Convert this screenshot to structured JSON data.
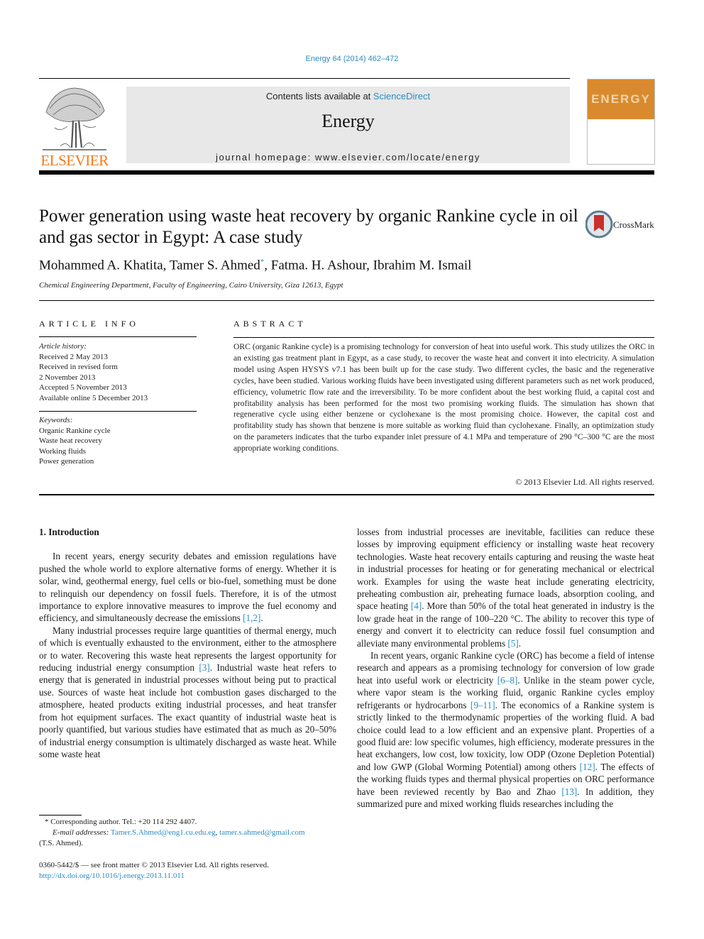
{
  "header": {
    "citation": "Energy 64 (2014) 462–472",
    "contents_prefix": "Contents lists available at ",
    "contents_link": "ScienceDirect",
    "journal_name": "Energy",
    "homepage": "journal homepage: www.elsevier.com/locate/energy",
    "publisher": "ELSEVIER",
    "cover_title": "ENERGY",
    "crossmark_label": "CrossMark"
  },
  "article": {
    "title": "Power generation using waste heat recovery by organic Rankine cycle in oil and gas sector in Egypt: A case study",
    "authors_before": "Mohammed A. Khatita, Tamer S. Ahmed",
    "authors_mark": "*",
    "authors_after": ", Fatma. H. Ashour, Ibrahim M. Ismail",
    "affiliation": "Chemical Engineering Department, Faculty of Engineering, Cairo University, Giza 12613, Egypt"
  },
  "article_info": {
    "heading": "ARTICLE INFO",
    "history_label": "Article history:",
    "history": [
      "Received 2 May 2013",
      "Received in revised form",
      "2 November 2013",
      "Accepted 5 November 2013",
      "Available online 5 December 2013"
    ],
    "keywords_label": "Keywords:",
    "keywords": [
      "Organic Rankine cycle",
      "Waste heat recovery",
      "Working fluids",
      "Power generation"
    ]
  },
  "abstract": {
    "heading": "ABSTRACT",
    "text": "ORC (organic Rankine cycle) is a promising technology for conversion of heat into useful work. This study utilizes the ORC in an existing gas treatment plant in Egypt, as a case study, to recover the waste heat and convert it into electricity. A simulation model using Aspen HYSYS v7.1 has been built up for the case study. Two different cycles, the basic and the regenerative cycles, have been studied. Various working fluids have been investigated using different parameters such as net work produced, efficiency, volumetric flow rate and the irreversibility. To be more confident about the best working fluid, a capital cost and profitability analysis has been performed for the most two promising working fluids. The simulation has shown that regenerative cycle using either benzene or cyclohexane is the most promising choice. However, the capital cost and profitability study has shown that benzene is more suitable as working fluid than cyclohexane. Finally, an optimization study on the parameters indicates that the turbo expander inlet pressure of 4.1 MPa and temperature of 290 °C–300 °C are the most appropriate working conditions.",
    "copyright": "© 2013 Elsevier Ltd. All rights reserved."
  },
  "body": {
    "section_heading": "1.  Introduction",
    "left": {
      "p1_text": "In recent years, energy security debates and emission regulations have pushed the whole world to explore alternative forms of energy. Whether it is solar, wind, geothermal energy, fuel cells or bio-fuel, something must be done to relinquish our dependency on fossil fuels. Therefore, it is of the utmost importance to explore innovative measures to improve the fuel economy and efficiency, and simultaneously decrease the emissions ",
      "p1_ref": "[1,2]",
      "p1_end": ".",
      "p2_a": "Many industrial processes require large quantities of thermal energy, much of which is eventually exhausted to the environment, either to the atmosphere or to water. Recovering this waste heat represents the largest opportunity for reducing industrial energy consumption ",
      "p2_ref": "[3]",
      "p2_b": ". Industrial waste heat refers to energy that is generated in industrial processes without being put to practical use. Sources of waste heat include hot combustion gases discharged to the atmosphere, heated products exiting industrial processes, and heat transfer from hot equipment surfaces. The exact quantity of industrial waste heat is poorly quantified, but various studies have estimated that as much as 20–50% of industrial energy consumption is ultimately discharged as waste heat. While some waste heat"
    },
    "right": {
      "p1_a": "losses from industrial processes are inevitable, facilities can reduce these losses by improving equipment efficiency or installing waste heat recovery technologies. Waste heat recovery entails capturing and reusing the waste heat in industrial processes for heating or for generating mechanical or electrical work. Examples for using the waste heat include generating electricity, preheating combustion air, preheating furnace loads, absorption cooling, and space heating ",
      "p1_ref1": "[4]",
      "p1_b": ". More than 50% of the total heat generated in industry is the low grade heat in the range of 100–220 °C. The ability to recover this type of energy and convert it to electricity can reduce fossil fuel consumption and alleviate many environmental problems ",
      "p1_ref2": "[5]",
      "p1_end": ".",
      "p2_a": "In recent years, organic Rankine cycle (ORC) has become a field of intense research and appears as a promising technology for conversion of low grade heat into useful work or electricity ",
      "p2_ref1": "[6–8]",
      "p2_b": ". Unlike in the steam power cycle, where vapor steam is the working fluid, organic Rankine cycles employ refrigerants or hydrocarbons ",
      "p2_ref2": "[9–11]",
      "p2_c": ". The economics of a Rankine system is strictly linked to the thermodynamic properties of the working fluid. A bad choice could lead to a low efficient and an expensive plant. Properties of a good fluid are: low specific volumes, high efficiency, moderate pressures in the heat exchangers, low cost, low toxicity, low ODP (Ozone Depletion Potential) and low GWP (Global Worming Potential) among others ",
      "p2_ref3": "[12]",
      "p2_d": ". The effects of the working fluids types and thermal physical properties on ORC performance have been reviewed recently by Bao and Zhao ",
      "p2_ref4": "[13]",
      "p2_e": ". In addition, they summarized pure and mixed working fluids researches including the"
    }
  },
  "footnote": {
    "corresponding": "* Corresponding author. Tel.: +20 114 292 4407.",
    "email_label": "E-mail addresses:",
    "email1": "Tamer.S.Ahmed@eng1.cu.edu.eg",
    "sep": ", ",
    "email2": "tamer.s.ahmed@gmail.com",
    "email_owner": "(T.S. Ahmed).",
    "front_matter": "0360-5442/$ — see front matter © 2013 Elsevier Ltd. All rights reserved.",
    "doi": "http://dx.doi.org/10.1016/j.energy.2013.11.011"
  },
  "colors": {
    "link": "#2a8cc4",
    "elsevier_orange": "#f07a1e",
    "cover_orange": "#d98a2e",
    "banner_gray": "#e8e8e8"
  }
}
